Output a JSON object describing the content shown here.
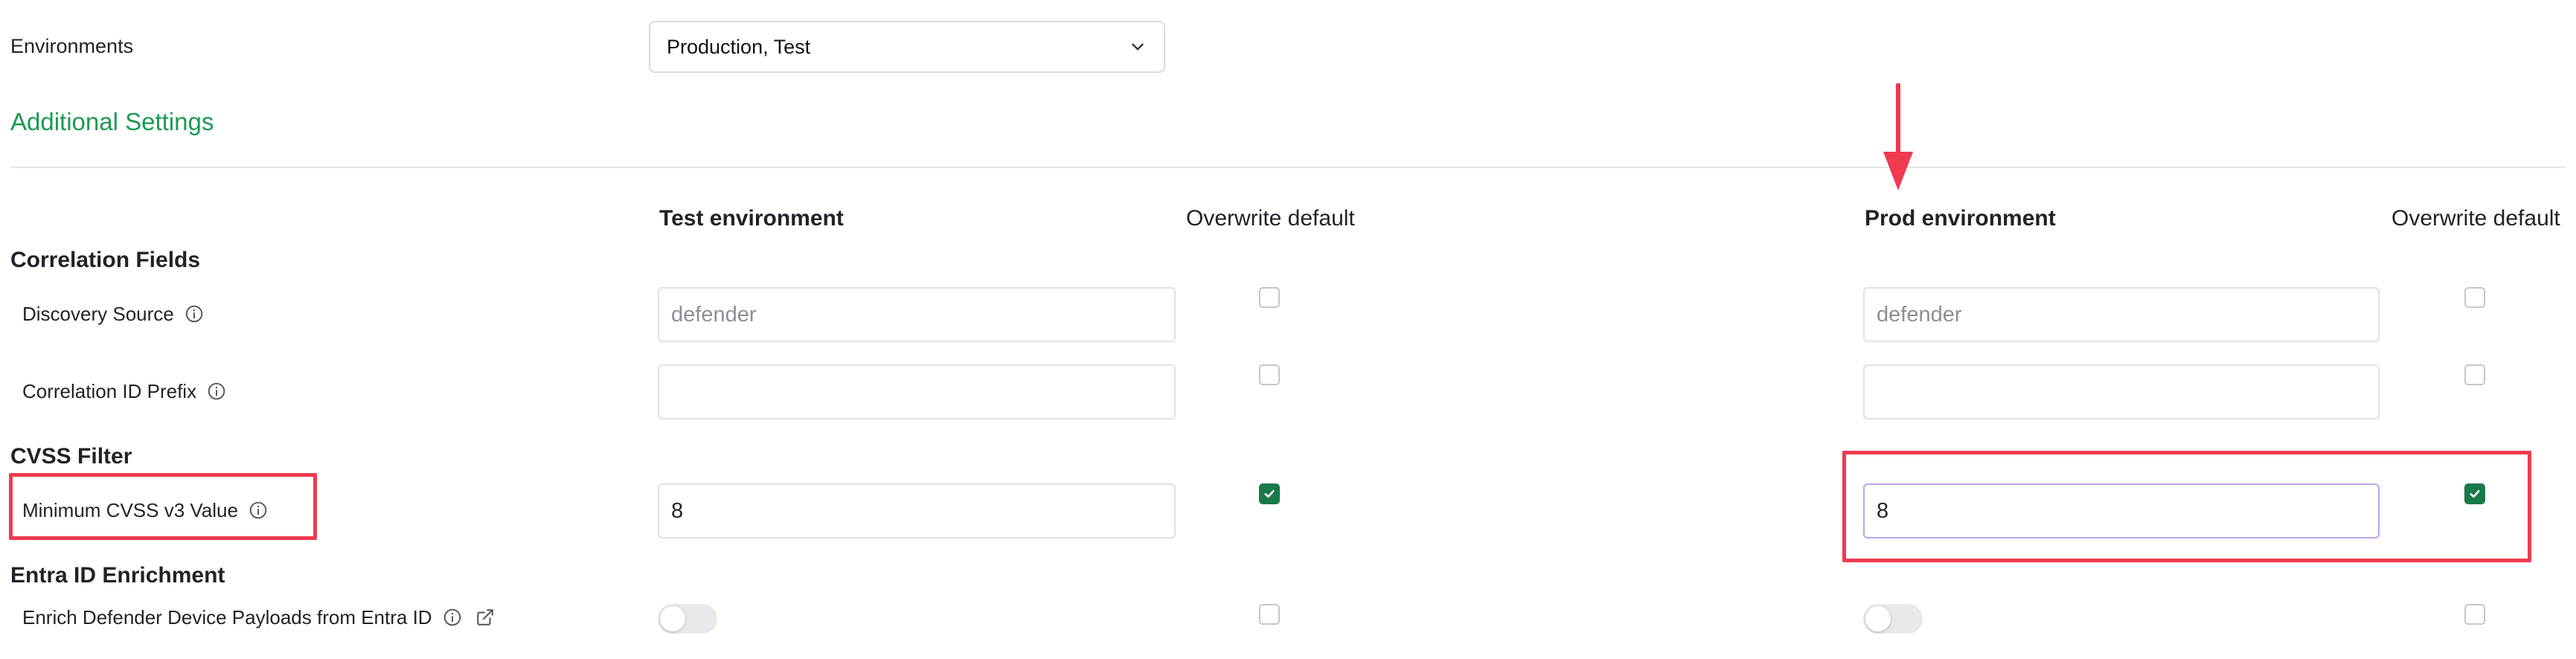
{
  "environments": {
    "label": "Environments",
    "selected_value": "Production, Test"
  },
  "additional_settings": {
    "title": "Additional Settings"
  },
  "columns": {
    "test_env": "Test environment",
    "test_overwrite": "Overwrite default",
    "prod_env": "Prod environment",
    "prod_overwrite": "Overwrite default"
  },
  "groups": {
    "correlation": "Correlation Fields",
    "cvss": "CVSS Filter",
    "entra": "Entra ID Enrichment"
  },
  "fields": {
    "discovery_source": {
      "label": "Discovery Source",
      "test_placeholder": "defender",
      "prod_placeholder": "defender",
      "test_overwrite": false,
      "prod_overwrite": false
    },
    "correlation_id_prefix": {
      "label": "Correlation ID Prefix",
      "test_value": "",
      "prod_value": "",
      "test_overwrite": false,
      "prod_overwrite": false
    },
    "min_cvss": {
      "label": "Minimum CVSS v3 Value",
      "test_value": "8",
      "prod_value": "8",
      "test_overwrite": true,
      "prod_overwrite": true
    },
    "enrich_entra": {
      "label": "Enrich Defender Device Payloads from Entra ID",
      "test_enabled": false,
      "prod_enabled": false,
      "test_overwrite": false,
      "prod_overwrite": false
    }
  },
  "colors": {
    "accent_green": "#1a9a52",
    "checkbox_green": "#187a48",
    "annotation_red": "#ef3a4f"
  },
  "icons": {
    "dropdown": "chevron-down-icon",
    "info": "info-icon",
    "external": "external-link-icon",
    "annotation": "down-arrow-annotation"
  }
}
